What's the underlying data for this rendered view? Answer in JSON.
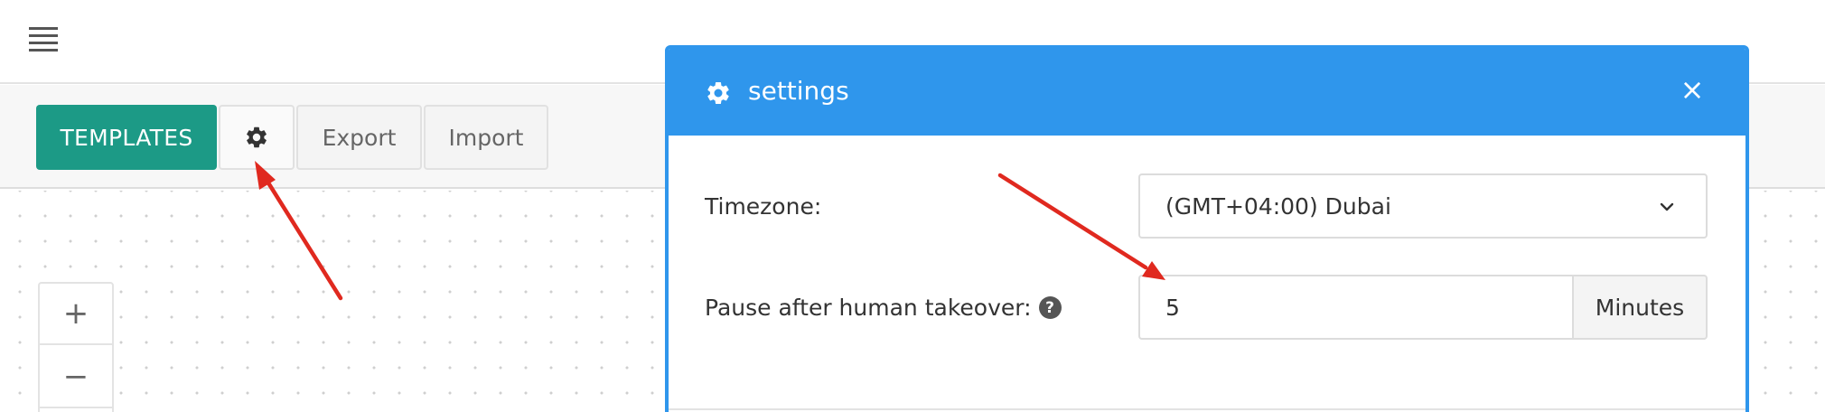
{
  "topbar": {
    "menu_icon": "hamburger-menu-icon"
  },
  "toolbar": {
    "templates_label": "TEMPLATES",
    "settings_icon": "gear-icon",
    "export_label": "Export",
    "import_label": "Import"
  },
  "canvas": {
    "zoom_in_label": "+",
    "zoom_out_label": "−"
  },
  "modal": {
    "title": "settings",
    "title_icon": "gear-icon",
    "close_label": "×",
    "timezone_label": "Timezone:",
    "timezone_value": "(GMT+04:00) Dubai",
    "pause_label": "Pause after human takeover:",
    "pause_help": "?",
    "pause_value": "5",
    "pause_unit": "Minutes"
  },
  "colors": {
    "accent_teal": "#1c9a86",
    "modal_blue": "#2f96ec",
    "arrow_red": "#e0291f"
  }
}
